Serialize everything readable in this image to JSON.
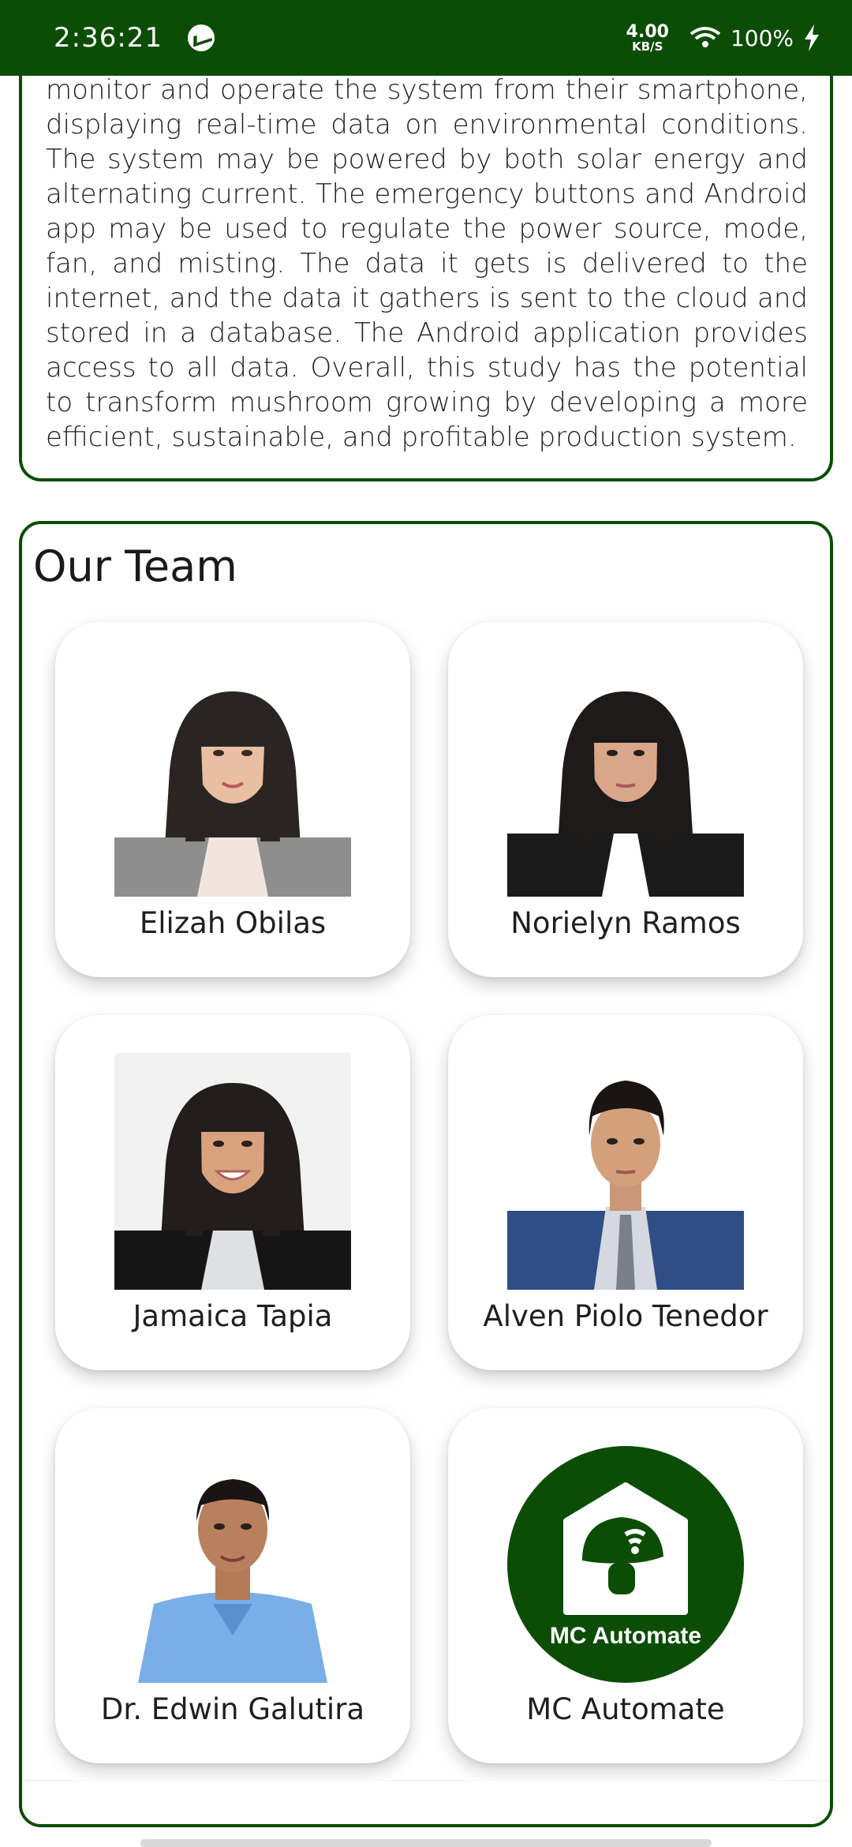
{
  "status_bar": {
    "time": "2:36:21",
    "speed_value": "4.00",
    "speed_unit": "KB/S",
    "battery": "100%"
  },
  "description": {
    "text": "monitor and operate the system from their smartphone, displaying real-time data on environmental conditions. The system may be powered by both solar energy and alternating current. The emergency buttons and Android app may be used to regulate the power source, mode, fan, and misting. The data it gets is delivered to the internet, and the data it gathers is sent to the cloud and stored in a database. The Android application provides access to all data. Overall, this study has the potential to transform mushroom growing by developing a more efficient, sustainable, and profitable production system."
  },
  "team": {
    "title": "Our Team",
    "members": [
      {
        "name": "Elizah Obilas"
      },
      {
        "name": "Norielyn Ramos"
      },
      {
        "name": "Jamaica Tapia"
      },
      {
        "name": "Alven Piolo Tenedor"
      },
      {
        "name": "Dr. Edwin Galutira"
      },
      {
        "name": "MC Automate"
      }
    ],
    "logo_text": "MC Automate"
  },
  "colors": {
    "brand_green": "#0b4d05",
    "card_bg": "#ffffff"
  }
}
